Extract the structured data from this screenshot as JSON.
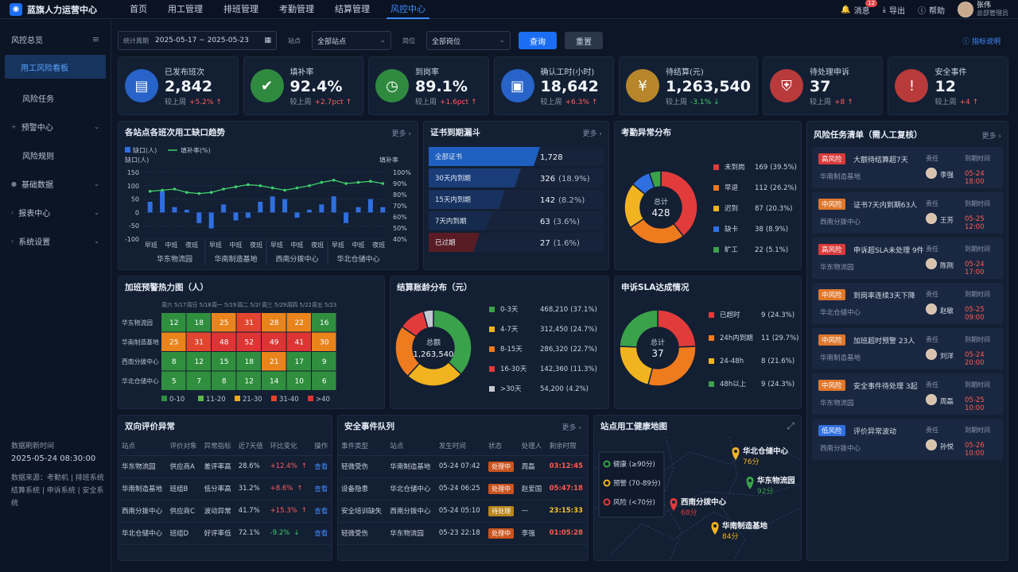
{
  "app": {
    "title": "蓝旗人力运营中心"
  },
  "nav": [
    {
      "label": "首页"
    },
    {
      "label": "用工管理"
    },
    {
      "label": "排班管理"
    },
    {
      "label": "考勤管理"
    },
    {
      "label": "结算管理"
    },
    {
      "label": "风控中心"
    }
  ],
  "topright": {
    "messages": "消息",
    "msg_count": "12",
    "export": "导出",
    "help": "帮助",
    "user": "张伟",
    "role": "总部管理员"
  },
  "sidebar": {
    "items": [
      {
        "label": "风控总览"
      },
      {
        "label": "用工风险看板"
      },
      {
        "label": "风险任务"
      },
      {
        "label": "预警中心"
      },
      {
        "label": "风险规则"
      },
      {
        "label": "基础数据"
      },
      {
        "label": "报表中心"
      },
      {
        "label": "系统设置"
      }
    ],
    "refresh_label": "数据刷新时间",
    "refresh_time": "2025-05-24 08:30:00",
    "source1": "数据来源：考勤机 | 排班系统",
    "source2": "结算系统 | 申诉系统 | 安全系统"
  },
  "filter": {
    "period_label": "统计周期",
    "period": "2025-05-17 ~ 2025-05-23",
    "site_label": "站点",
    "site": "全部站点",
    "post_label": "岗位",
    "post": "全部岗位",
    "query": "查询",
    "reset": "重置",
    "help": "指标说明"
  },
  "kpis": [
    {
      "title": "已发布班次",
      "value": "2,842",
      "delta_label": "较上周",
      "delta": "+5.2%",
      "color": "#2763c8",
      "icon": "calendar-icon"
    },
    {
      "title": "填补率",
      "value": "92.4%",
      "delta_label": "较上周",
      "delta": "+2.7pct",
      "color": "#2f8a3f",
      "icon": "user-check-icon"
    },
    {
      "title": "到岗率",
      "value": "89.1%",
      "delta_label": "较上周",
      "delta": "+1.6pct",
      "color": "#2f8a3f",
      "icon": "clock-icon"
    },
    {
      "title": "确认工时(小时)",
      "value": "18,642",
      "delta_label": "较上周",
      "delta": "+6.3%",
      "color": "#2763c8",
      "icon": "doc-icon"
    },
    {
      "title": "待结算(元)",
      "value": "1,263,540",
      "delta_label": "较上周",
      "delta": "-3.1%",
      "color": "#b7862a",
      "icon": "yen-icon"
    },
    {
      "title": "待处理申诉",
      "value": "37",
      "delta_label": "较上周",
      "delta": "+8",
      "color": "#b93a3a",
      "icon": "shield-icon"
    },
    {
      "title": "安全事件",
      "value": "12",
      "delta_label": "较上周",
      "delta": "+4",
      "color": "#b93a3a",
      "icon": "warning-icon"
    }
  ],
  "trend": {
    "title": "各站点各班次用工缺口趋势",
    "more": "更多",
    "legend_gap": "缺口(人)",
    "legend_fill": "填补率(%)",
    "ylabel_left": "缺口(人)",
    "ylabel_right": "填补率",
    "left_ticks": [
      "150",
      "100",
      "50",
      "0",
      "-50",
      "-100"
    ],
    "right_ticks": [
      "100%",
      "90%",
      "80%",
      "70%",
      "60%",
      "50%",
      "40%"
    ],
    "shifts": [
      "早班",
      "中班",
      "夜班"
    ],
    "sites": [
      "华东物流园",
      "华南制造基地",
      "西南分拨中心",
      "华北仓储中心"
    ]
  },
  "chart_data": [
    {
      "type": "bar",
      "title": "各站点各班次用工缺口趋势",
      "series": [
        {
          "name": "缺口(人)",
          "values": [
            40,
            80,
            20,
            10,
            -40,
            -60,
            30,
            -30,
            -20,
            40,
            60,
            50,
            -20,
            10,
            30,
            60,
            -40,
            20,
            50,
            20
          ]
        },
        {
          "name": "填补率(%)",
          "values": [
            83,
            84,
            85,
            82,
            81,
            82,
            85,
            87,
            89,
            88,
            86,
            84,
            86,
            88,
            91,
            93,
            90,
            91,
            92,
            90
          ]
        }
      ],
      "ylim": [
        -100,
        150
      ]
    },
    {
      "type": "pie",
      "title": "考勤异常分布",
      "total_label": "总计",
      "total": "428",
      "categories": [
        "未到岗",
        "早退",
        "迟到",
        "缺卡",
        "旷工"
      ],
      "values": [
        169,
        112,
        87,
        38,
        22
      ],
      "pct": [
        "39.5%",
        "26.2%",
        "20.3%",
        "8.9%",
        "5.1%"
      ],
      "colors": [
        "#e13b3b",
        "#ef7b1f",
        "#f2b320",
        "#2f6fe0",
        "#3aa24a"
      ]
    },
    {
      "type": "pie",
      "title": "结算账龄分布（元）",
      "total_label": "总额",
      "total": "1,263,540",
      "categories": [
        "0-3天",
        "4-7天",
        "8-15天",
        "16-30天",
        ">30天"
      ],
      "values": [
        468210,
        312450,
        286320,
        142360,
        54200
      ],
      "display": [
        "468,210",
        "312,450",
        "286,320",
        "142,360",
        "54,200"
      ],
      "pct": [
        "37.1%",
        "24.7%",
        "22.7%",
        "11.3%",
        "4.2%"
      ],
      "colors": [
        "#3aa24a",
        "#f2b320",
        "#ef7b1f",
        "#e13b3b",
        "#c5c9d1"
      ]
    },
    {
      "type": "pie",
      "title": "申诉SLA达成情况",
      "total_label": "总计",
      "total": "37",
      "categories": [
        "已超时",
        "24h内到期",
        "24-48h",
        "48h以上"
      ],
      "values": [
        9,
        11,
        8,
        9
      ],
      "pct": [
        "24.3%",
        "29.7%",
        "21.6%",
        "24.3%"
      ],
      "colors": [
        "#e13b3b",
        "#ef7b1f",
        "#f2b320",
        "#3aa24a"
      ]
    },
    {
      "type": "heatmap",
      "title": "加班预警热力图（人）",
      "columns": [
        "周六 5/17",
        "周日 5/18",
        "周一 5/19",
        "周二 5/2!",
        "周三 5/29",
        "周四 5/22",
        "周五 5/23"
      ],
      "rows": [
        "华东物流园",
        "华南制造基地",
        "西南分拨中心",
        "华北仓储中心"
      ],
      "values": [
        [
          12,
          18,
          25,
          31,
          28,
          22,
          16
        ],
        [
          25,
          31,
          48,
          52,
          49,
          41,
          30
        ],
        [
          8,
          12,
          15,
          18,
          21,
          17,
          9
        ],
        [
          5,
          7,
          8,
          12,
          14,
          10,
          6
        ]
      ]
    }
  ],
  "funnel": {
    "title": "证书到期漏斗",
    "more": "更多",
    "rows": [
      {
        "label": "全部证书",
        "value": "1,728",
        "pct": ""
      },
      {
        "label": "30天内到期",
        "value": "326",
        "pct": "(18.9%)"
      },
      {
        "label": "15天内到期",
        "value": "142",
        "pct": "(8.2%)"
      },
      {
        "label": "7天内到期",
        "value": "63",
        "pct": "(3.6%)"
      },
      {
        "label": "已过期",
        "value": "27",
        "pct": "(1.6%)"
      }
    ]
  },
  "heat_legend": [
    "0-10",
    "11-20",
    "21-30",
    "31-40",
    ">40"
  ],
  "risklist": {
    "title": "风险任务清单（需人工复核）",
    "more": "更多",
    "owner_label": "责任",
    "deadline_label": "到期时间",
    "items": [
      {
        "level": "高风险",
        "color": "#d93a3a",
        "title": "大额待结算超7天",
        "site": "华南制造基地",
        "owner": "李强",
        "due": "05-24 18:00"
      },
      {
        "level": "中风险",
        "color": "#e0772a",
        "title": "证书7天内到期63人",
        "site": "西南分拨中心",
        "owner": "王芳",
        "due": "05-25 12:00"
      },
      {
        "level": "高风险",
        "color": "#d93a3a",
        "title": "申诉超SLA未处理 9件",
        "site": "华东物流园",
        "owner": "陈刚",
        "due": "05-24 17:00"
      },
      {
        "level": "中风险",
        "color": "#e0772a",
        "title": "到岗率连续3天下降",
        "site": "华北仓储中心",
        "owner": "赵敏",
        "due": "05-25 09:00"
      },
      {
        "level": "中风险",
        "color": "#e0772a",
        "title": "加班超时预警 23人",
        "site": "华南制造基地",
        "owner": "刘洋",
        "due": "05-24 20:00"
      },
      {
        "level": "中风险",
        "color": "#e0772a",
        "title": "安全事件待处理 3起",
        "site": "华东物流园",
        "owner": "周磊",
        "due": "05-25 10:00"
      },
      {
        "level": "低风险",
        "color": "#2f6fe0",
        "title": "评价异常波动",
        "site": "西南分拨中心",
        "owner": "孙悦",
        "due": "05-26 10:00"
      }
    ]
  },
  "eval": {
    "title": "双向评价异常",
    "headers": [
      "站点",
      "评价对象",
      "异常指标",
      "近7天值",
      "环比变化",
      "操作"
    ],
    "rows": [
      {
        "site": "华东物流园",
        "obj": "供应商A",
        "metric": "差评率高",
        "val": "28.6%",
        "chg": "+12.4%",
        "op": "查看",
        "dir": "up"
      },
      {
        "site": "华南制造基地",
        "obj": "班组B",
        "metric": "低分率高",
        "val": "31.2%",
        "chg": "+8.6%",
        "op": "查看",
        "dir": "up"
      },
      {
        "site": "西南分拨中心",
        "obj": "供应商C",
        "metric": "波动异常",
        "val": "41.7%",
        "chg": "+15.3%",
        "op": "查看",
        "dir": "up"
      },
      {
        "site": "华北仓储中心",
        "obj": "班组D",
        "metric": "好评率低",
        "val": "72.1%",
        "chg": "-9.2%",
        "op": "查看",
        "dir": "down"
      }
    ]
  },
  "safety": {
    "title": "安全事件队列",
    "more": "更多",
    "headers": [
      "事件类型",
      "站点",
      "发生时间",
      "状态",
      "处理人",
      "剩余时限"
    ],
    "rows": [
      {
        "type": "轻微受伤",
        "site": "华南制造基地",
        "time": "05-24 07:42",
        "status": "处理中",
        "sc": "#c9541f",
        "owner": "周磊",
        "left": "03:12:45",
        "lc": "#ff5a4f"
      },
      {
        "type": "设备隐患",
        "site": "华北仓储中心",
        "time": "05-24 06:25",
        "status": "处理中",
        "sc": "#c9541f",
        "owner": "赵爱国",
        "left": "05:47:18",
        "lc": "#ff5a4f"
      },
      {
        "type": "安全培训缺失",
        "site": "西南分拨中心",
        "time": "05-24 05:10",
        "status": "待处理",
        "sc": "#b8861d",
        "owner": "—",
        "left": "23:15:33",
        "lc": "#f2c230"
      },
      {
        "type": "轻微受伤",
        "site": "华东物流园",
        "time": "05-23 22:18",
        "status": "处理中",
        "sc": "#c9541f",
        "owner": "李强",
        "left": "01:05:28",
        "lc": "#ff5a4f"
      }
    ]
  },
  "map": {
    "title": "站点用工健康地图",
    "legend": [
      {
        "label": "健康 (≥90分)",
        "color": "#3aa24a"
      },
      {
        "label": "预警 (70-89分)",
        "color": "#f2b320"
      },
      {
        "label": "风险 (<70分)",
        "color": "#e13b3b"
      }
    ],
    "sites": [
      {
        "name": "华北仓储中心",
        "score": "76分",
        "color": "#f2b320"
      },
      {
        "name": "华东物流园",
        "score": "92分",
        "color": "#3aa24a"
      },
      {
        "name": "西南分拨中心",
        "score": "68分",
        "color": "#e13b3b"
      },
      {
        "name": "华南制造基地",
        "score": "84分",
        "color": "#f2b320"
      }
    ]
  }
}
